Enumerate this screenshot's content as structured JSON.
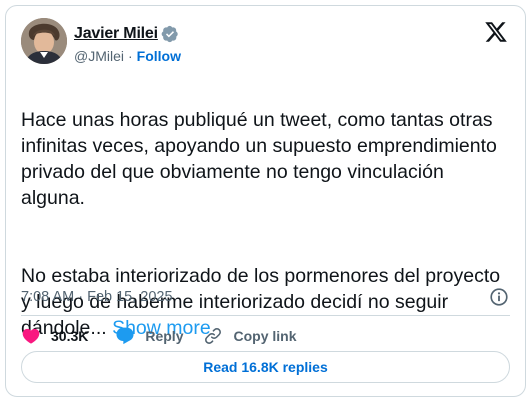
{
  "author": {
    "name": "Javier Milei",
    "handle": "@JMilei",
    "separator": "·",
    "follow_label": "Follow",
    "verified": true,
    "avatar_icon": "profile-photo"
  },
  "brand": {
    "logo_icon": "x-logo-icon"
  },
  "tweet": {
    "paragraph_1": "Hace unas horas publiqué un tweet, como tantas otras infinitas veces, apoyando un supuesto emprendimiento privado del que obviamente no tengo vinculación alguna.",
    "paragraph_2": "No estaba interiorizado de los pormenores del proyecto y luego de haberme interiorizado decidí no seguir dándole...",
    "show_more_label": "Show more"
  },
  "meta": {
    "timestamp": "7:08 AM · Feb 15, 2025",
    "info_icon": "info-icon"
  },
  "actions": {
    "likes": "30.3K",
    "reply_label": "Reply",
    "copy_link_label": "Copy link"
  },
  "replies_button": {
    "label": "Read 16.8K replies"
  },
  "colors": {
    "like": "#f91880",
    "reply": "#1d9bf0",
    "link": "#006fd6",
    "text": "#0f1419",
    "muted": "#536471",
    "border": "#cfd9de"
  }
}
